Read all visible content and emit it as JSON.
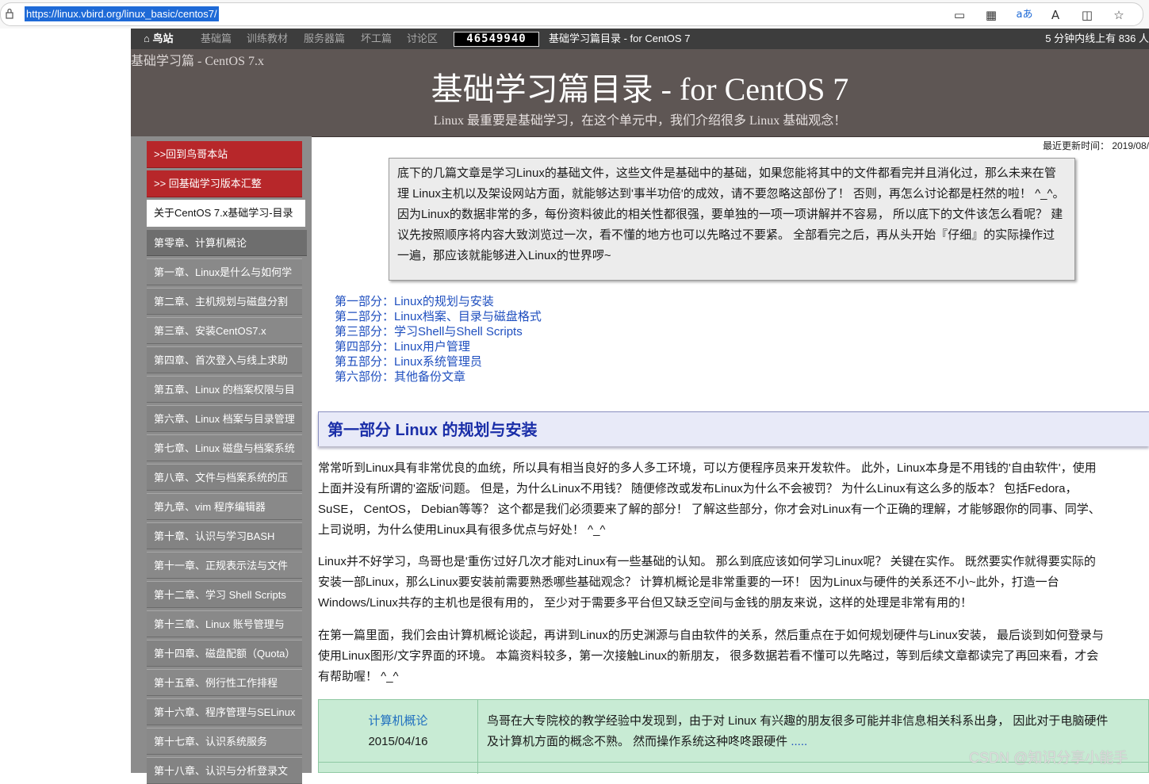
{
  "browser": {
    "url": "https://linux.vbird.org/linux_basic/centos7/",
    "toolbar_icons": [
      "screen-icon",
      "grid-icon",
      "translate-icon",
      "read-aloud-icon",
      "split-icon",
      "favorite-icon"
    ],
    "toolbar_glyphs": [
      "▭",
      "▦",
      "aあ",
      "A",
      "◫",
      "☆"
    ]
  },
  "nav": {
    "home_label": "鸟站",
    "items": [
      "基础篇",
      "训练教材",
      "服务器篇",
      "坏工篇",
      "讨论区"
    ],
    "counter": "46549940",
    "page_title": "基础学习篇目录 - for CentOS 7",
    "online": "5 分钟内线上有 836 人"
  },
  "banner": {
    "crumb": "基础学习篇 - CentOS 7.x",
    "title": "基础学习篇目录 - for CentOS 7",
    "subtitle": "Linux 最重要是基础学习，在这个单元中，我们介绍很多 Linux 基础观念！"
  },
  "sidebar": {
    "items": [
      ">>回到鸟哥本站",
      ">> 回基础学习版本汇整",
      "关于CentOS 7.x基础学习-目录",
      "第零章、计算机概论",
      "第一章、Linux是什么与如何学",
      "第二章、主机规划与磁盘分割",
      "第三章、安装CentOS7.x",
      "第四章、首次登入与线上求助",
      "第五章、Linux 的档案权限与目",
      "第六章、Linux 档案与目录管理",
      "第七章、Linux 磁盘与档案系统",
      "第八章、文件与档案系统的压",
      "第九章、vim 程序编辑器",
      "第十章、认识与学习BASH",
      "第十一章、正规表示法与文件",
      "第十二章、学习 Shell Scripts",
      "第十三章、Linux 账号管理与",
      "第十四章、磁盘配额（Quota）",
      "第十五章、例行性工作排程",
      "第十六章、程序管理与SELinux",
      "第十七章、认识系统服务",
      "第十八章、认识与分析登录文"
    ]
  },
  "main": {
    "updated": "最近更新时间： 2019/08/",
    "intro": "底下的几篇文章是学习Linux的基础文件，这些文件是基础中的基础，如果您能将其中的文件都看完并且消化过，那么未来在管理 Linux主机以及架设网站方面，就能够达到'事半功倍'的成效，请不要忽略这部份了！ 否则，再怎么讨论都是枉然的啦！ ^_^。 因为Linux的数据非常的多，每份资料彼此的相关性都很强，要单独的一项一项讲解并不容易， 所以底下的文件该怎么看呢？ 建议先按照顺序将内容大致浏览过一次，看不懂的地方也可以先略过不要紧。 全部看完之后，再从头开始『仔细』的实际操作过一遍，那应该就能够进入Linux的世界啰~",
    "toc": [
      "第一部分：Linux的规划与安装",
      "第二部分：Linux档案、目录与磁盘格式",
      "第三部分：学习Shell与Shell Scripts",
      "第四部分：Linux用户管理",
      "第五部分：Linux系统管理员",
      "第六部份：其他备份文章"
    ],
    "part1_heading": "第一部分 Linux 的规划与安装",
    "paragraphs": [
      [
        "常常听到Linux具有非常优良的血统，所以具有相当良好的多人多工环境，可以方便程序员来开发软件。 此外，Linux本身是不用钱的'自由软件'，使用",
        "上面并没有所谓的'盗版'问题。 但是，为什么Linux不用钱？ 随便修改或发布Linux为什么不会被罚？ 为什么Linux有这么多的版本？ 包括Fedora，",
        "SuSE， CentOS， Debian等等？ 这个都是我们必须要来了解的部分！ 了解这些部分，你才会对Linux有一个正确的理解，才能够跟你的同事、同学、",
        "上司说明，为什么使用Linux具有很多优点与好处！ ^_^"
      ],
      [
        "Linux并不好学习，鸟哥也是'重伤'过好几次才能对Linux有一些基础的认知。 那么到底应该如何学习Linux呢？ 关键在实作。 既然要实作就得要实际的",
        "安装一部Linux，那么Linux要安装前需要熟悉哪些基础观念？ 计算机概论是非常重要的一环！ 因为Linux与硬件的关系还不小~此外，打造一台",
        "Windows/Linux共存的主机也是很有用的， 至少对于需要多平台但又缺乏空间与金钱的朋友来说，这样的处理是非常有用的！"
      ],
      [
        "在第一篇里面，我们会由计算机概论谈起，再讲到Linux的历史渊源与自由软件的关系，然后重点在于如何规划硬件与Linux安装， 最后谈到如何登录与",
        "使用Linux图形/文字界面的环境。 本篇资料较多，第一次接触Linux的新朋友， 很多数据若看不懂可以先略过，等到后续文章都读完了再回来看，才会",
        "有帮助喔！ ^_^"
      ]
    ],
    "chapter_rows": [
      {
        "link": "计算机概论",
        "date": "2015/04/16",
        "desc_line1": "鸟哥在大专院校的教学经验中发现到，由于对 Linux 有兴趣的朋友很多可能并非信息相关科系出身， 因此对于电脑硬件",
        "desc_line2": "及计算机方面的概念不熟。 然而操作系统这种咚咚跟硬件",
        "more": " ....."
      }
    ]
  },
  "watermark": "CSDN @知识分享小能手",
  "colors": {
    "nav_bg": "#3d3d3d",
    "banner_bg": "#5e5654",
    "sidebar_red": "#b7272a",
    "sidebar_gray": "#898989",
    "link_blue": "#1f4fbf",
    "heading_blue": "#1a2ea8",
    "table_green": "#c8ebd4"
  }
}
